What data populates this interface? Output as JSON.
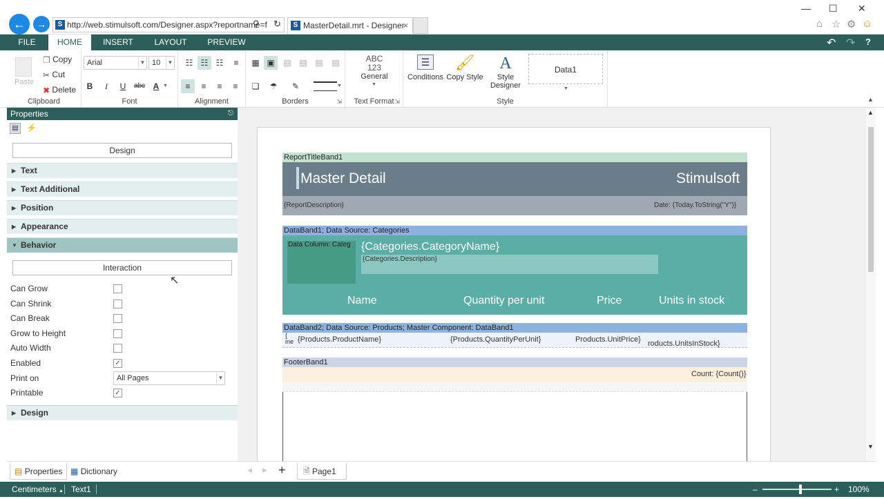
{
  "browser": {
    "url": "http://web.stimulsoft.com/Designer.aspx?reportname=f",
    "tab_title": "MasterDetail.mrt - Designer"
  },
  "menu": {
    "items": [
      "FILE",
      "HOME",
      "INSERT",
      "LAYOUT",
      "PREVIEW"
    ],
    "active": "HOME"
  },
  "ribbon": {
    "clipboard": {
      "paste": "Paste",
      "copy": "Copy",
      "cut": "Cut",
      "delete": "Delete",
      "label": "Clipboard"
    },
    "font": {
      "family": "Arial",
      "size": "10",
      "label": "Font"
    },
    "alignment": {
      "label": "Alignment"
    },
    "borders": {
      "label": "Borders"
    },
    "text_format": {
      "icon_text": "ABC 123",
      "value": "General",
      "label": "Text Format"
    },
    "style": {
      "conditions": "Conditions",
      "copy_style": "Copy Style",
      "style_designer": "Style Designer",
      "style_name": "Data1",
      "label": "Style"
    }
  },
  "properties": {
    "title": "Properties",
    "design_button": "Design",
    "categories": [
      "Text",
      "Text Additional",
      "Position",
      "Appearance",
      "Behavior"
    ],
    "behavior_open": "Behavior",
    "interaction_button": "Interaction",
    "rows": [
      {
        "label": "Can Grow",
        "checked": false
      },
      {
        "label": "Can Shrink",
        "checked": false
      },
      {
        "label": "Can Break",
        "checked": false
      },
      {
        "label": "Grow to Height",
        "checked": false
      },
      {
        "label": "Auto Width",
        "checked": false
      },
      {
        "label": "Enabled",
        "checked": true
      }
    ],
    "print_on_label": "Print on",
    "print_on_value": "All Pages",
    "printable_label": "Printable",
    "printable_checked": true,
    "design_category": "Design"
  },
  "bottom_tabs": {
    "properties": "Properties",
    "dictionary": "Dictionary"
  },
  "page_tab": "Page1",
  "status": {
    "units": "Centimeters",
    "component": "Text1",
    "zoom": "100%",
    "zoom_level": 0.55
  },
  "report": {
    "title_band": "ReportTitleBand1",
    "title": "Master Detail",
    "brand": "Stimulsoft",
    "description": "{ReportDescription}",
    "date": "Date: {Today.ToString(\"Y\")}",
    "databand1": "DataBand1; Data Source: Categories",
    "data_column": "Data Column: Categ",
    "category_name": "{Categories.CategoryName}",
    "category_desc": "{Categories.Description}",
    "headers": [
      "Name",
      "Quantity per unit",
      "Price",
      "Units in stock"
    ],
    "databand2": "DataBand2; Data Source: Products; Master Component: DataBand1",
    "detail_fields": [
      "{Products.ProductName}",
      "{Products.QuantityPerUnit}",
      "Products.UnitPrice}",
      "roducts.UnitsInStock}"
    ],
    "detail_prefix": "{ ine",
    "footer_band": "FooterBand1",
    "count": "Count: {Count()}"
  }
}
